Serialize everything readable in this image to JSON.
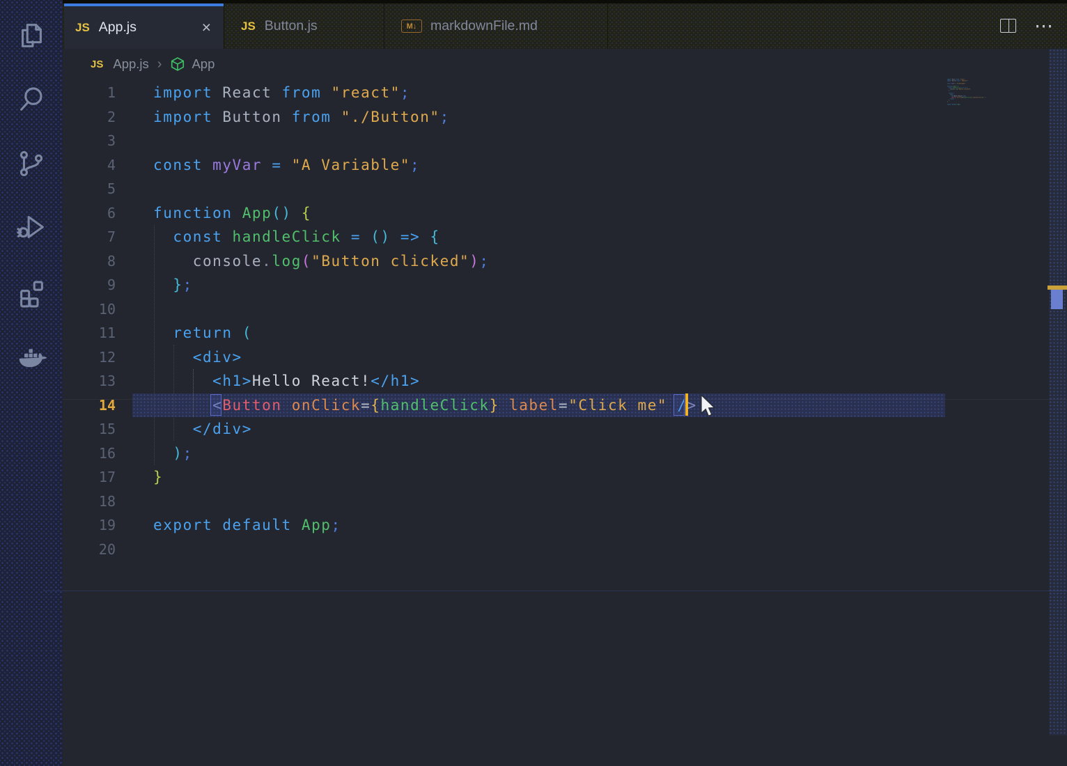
{
  "activity_bar": {
    "items": [
      "explorer",
      "search",
      "source-control",
      "run-and-debug",
      "extensions",
      "docker"
    ]
  },
  "tab_bar": {
    "tabs": [
      {
        "label": "App.js",
        "icon_text": "JS",
        "active": true,
        "close_glyph": "×"
      },
      {
        "label": "Button.js",
        "icon_text": "JS",
        "active": false
      },
      {
        "label": "markdownFile.md",
        "icon_text": "M↓",
        "active": false
      }
    ],
    "actions": {
      "split_editor": "split-editor",
      "more_glyph": "⋯"
    }
  },
  "breadcrumb": {
    "file_icon_text": "JS",
    "file": "App.js",
    "separator": "›",
    "symbol": "App"
  },
  "editor": {
    "language": "javascript",
    "active_line": 14,
    "total_lines": 20,
    "lines": [
      {
        "n": 1,
        "tokens": [
          [
            "kw",
            "import"
          ],
          [
            "id",
            " React"
          ],
          [
            "kw",
            " from"
          ],
          [
            "str",
            " \"react\""
          ],
          [
            "pun",
            ";"
          ]
        ]
      },
      {
        "n": 2,
        "tokens": [
          [
            "kw",
            "import"
          ],
          [
            "id",
            " Button"
          ],
          [
            "kw",
            " from"
          ],
          [
            "str",
            " \"./Button\""
          ],
          [
            "pun",
            ";"
          ]
        ]
      },
      {
        "n": 3,
        "tokens": []
      },
      {
        "n": 4,
        "tokens": [
          [
            "kw",
            "const"
          ],
          [
            "vr",
            " myVar"
          ],
          [
            "op",
            " ="
          ],
          [
            "str",
            " \"A Variable\""
          ],
          [
            "pun",
            ";"
          ]
        ]
      },
      {
        "n": 5,
        "tokens": []
      },
      {
        "n": 6,
        "tokens": [
          [
            "kw",
            "function"
          ],
          [
            "fn",
            " App"
          ],
          [
            "b2",
            "()"
          ],
          [
            "b1",
            " {"
          ]
        ]
      },
      {
        "n": 7,
        "tokens": [
          [
            "kw",
            "  const"
          ],
          [
            "fn",
            " handleClick"
          ],
          [
            "op",
            " ="
          ],
          [
            "b2",
            " ()"
          ],
          [
            "kw",
            " =>"
          ],
          [
            "b2",
            " {"
          ]
        ]
      },
      {
        "n": 8,
        "tokens": [
          [
            "id",
            "    console"
          ],
          [
            "dot",
            "."
          ],
          [
            "fn",
            "log"
          ],
          [
            "b3",
            "("
          ],
          [
            "str",
            "\"Button clicked\""
          ],
          [
            "b3",
            ")"
          ],
          [
            "pun",
            ";"
          ]
        ]
      },
      {
        "n": 9,
        "tokens": [
          [
            "b2",
            "  }"
          ],
          [
            "pun",
            ";"
          ]
        ]
      },
      {
        "n": 10,
        "tokens": []
      },
      {
        "n": 11,
        "tokens": [
          [
            "kw",
            "  return"
          ],
          [
            "b2",
            " ("
          ]
        ]
      },
      {
        "n": 12,
        "tokens": [
          [
            "tag",
            "    <div>"
          ]
        ]
      },
      {
        "n": 13,
        "tokens": [
          [
            "tag",
            "      <h1>"
          ],
          [
            "txt",
            "Hello React!"
          ],
          [
            "tag",
            "</h1>"
          ]
        ]
      },
      {
        "n": 14,
        "tokens": [
          [
            "ang",
            "      <"
          ],
          [
            "comp",
            "Button"
          ],
          [
            "attr",
            " onClick"
          ],
          [
            "eq",
            "="
          ],
          [
            "jsb",
            "{"
          ],
          [
            "fn",
            "handleClick"
          ],
          [
            "jsb",
            "}"
          ],
          [
            "attr",
            " label"
          ],
          [
            "eq",
            "="
          ],
          [
            "str",
            "\"Click me\""
          ],
          [
            "tag",
            " /"
          ],
          [
            "ang",
            ">"
          ]
        ]
      },
      {
        "n": 15,
        "tokens": [
          [
            "tag",
            "    </div>"
          ]
        ]
      },
      {
        "n": 16,
        "tokens": [
          [
            "b2",
            "  )"
          ],
          [
            "pun",
            ";"
          ]
        ]
      },
      {
        "n": 17,
        "tokens": [
          [
            "b1",
            "}"
          ]
        ]
      },
      {
        "n": 18,
        "tokens": []
      },
      {
        "n": 19,
        "tokens": [
          [
            "kw",
            "export"
          ],
          [
            "kw",
            " default"
          ],
          [
            "fn",
            " App"
          ],
          [
            "pun",
            ";"
          ]
        ]
      },
      {
        "n": 20,
        "tokens": []
      }
    ]
  },
  "colors": {
    "accent_tab_border": "#3e7de0",
    "caret": "#f0b428",
    "active_line_number": "#e2a83c",
    "line_highlight": "#293050",
    "keyword": "#4aa2f0",
    "string": "#dfaa4e",
    "function_name": "#52bf6d",
    "component": "#e25d6d",
    "attribute": "#dc8a50",
    "variable": "#9b7ade",
    "js_badge": "#e5c244",
    "ruler_cursor_marker": "#caa03a",
    "ruler_selection_marker": "#6b7fd0"
  }
}
